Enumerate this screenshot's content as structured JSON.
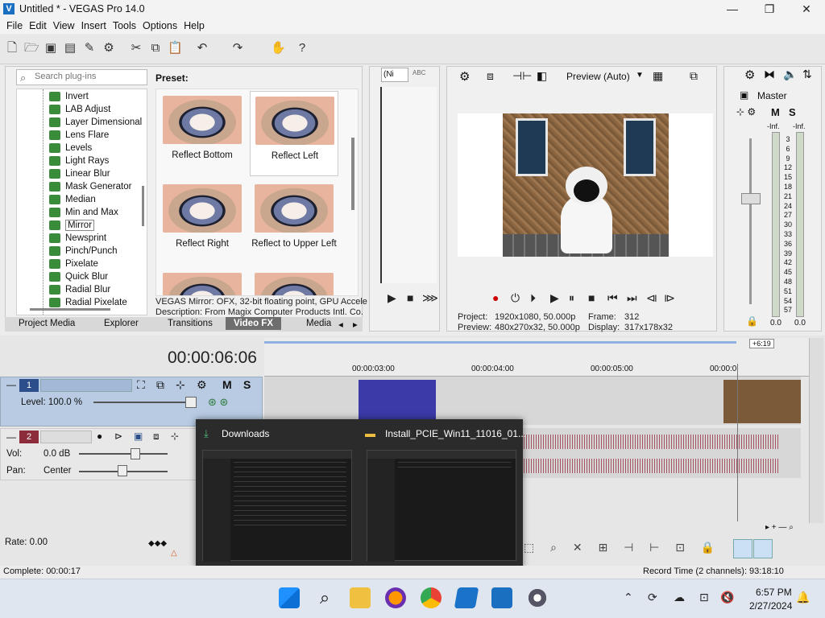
{
  "window": {
    "title": "Untitled * - VEGAS Pro 14.0",
    "logo": "V",
    "minimize": "—",
    "maximize": "❐",
    "close": "✕"
  },
  "menu": [
    "File",
    "Edit",
    "View",
    "Insert",
    "Tools",
    "Options",
    "Help"
  ],
  "plugins": {
    "search_placeholder": "Search plug-ins",
    "items": [
      "Invert",
      "LAB Adjust",
      "Layer Dimensional",
      "Lens Flare",
      "Levels",
      "Light Rays",
      "Linear Blur",
      "Mask Generator",
      "Median",
      "Min and Max",
      "Mirror",
      "Newsprint",
      "Pinch/Punch",
      "Pixelate",
      "Quick Blur",
      "Radial Blur",
      "Radial Pixelate"
    ],
    "selected": "Mirror"
  },
  "preset": {
    "header": "Preset:",
    "items": [
      "Reflect Bottom",
      "Reflect Left",
      "Reflect Right",
      "Reflect to Upper Left"
    ],
    "selected": "Reflect Left",
    "description_line1": "VEGAS Mirror: OFX, 32-bit floating point, GPU Accele",
    "description_line2": "Description: From Magix Computer Products Intl. Co."
  },
  "tabs": [
    "Project Media",
    "Explorer",
    "Transitions",
    "Video FX",
    "Media"
  ],
  "active_tab": "Video FX",
  "trimmer": {
    "zoom": "(Ni",
    "abc": "ABC"
  },
  "preview": {
    "mode": "Preview (Auto)",
    "project_label": "Project:",
    "project_value": "1920x1080, 50.000p",
    "preview_label": "Preview:",
    "preview_value": "480x270x32, 50.000p",
    "frame_label": "Frame:",
    "frame_value": "312",
    "display_label": "Display:",
    "display_value": "317x178x32"
  },
  "master": {
    "title": "Master",
    "m": "M",
    "s": "S",
    "inf_left": "-Inf.",
    "inf_right": "-Inf.",
    "scale": [
      "3",
      "6",
      "9",
      "12",
      "15",
      "18",
      "21",
      "24",
      "27",
      "30",
      "33",
      "36",
      "39",
      "42",
      "45",
      "48",
      "51",
      "54",
      "57"
    ],
    "bottom_left": "0.0",
    "bottom_right": "0.0"
  },
  "timeline": {
    "timecode": "00:00:06:06",
    "marker": "+6:19",
    "ruler": [
      "00:00:03:00",
      "00:00:04:00",
      "00:00:05:00",
      "00:00:0"
    ],
    "track1": {
      "number": "1",
      "m": "M",
      "s": "S",
      "level": "Level: 100.0 %"
    },
    "track2": {
      "number": "2",
      "vol": "Vol:",
      "vol_value": "0.0 dB",
      "pan": "Pan:",
      "pan_value": "Center"
    },
    "rate": "Rate: 0.00"
  },
  "taskpopup": {
    "item1": "Downloads",
    "item2": "Install_PCIE_Win11_11016_01..."
  },
  "status": {
    "complete": "Complete: 00:00:17",
    "record": "Record Time (2 channels): 93:18:10"
  },
  "taskbar": {
    "time": "6:57 PM",
    "date": "2/27/2024"
  },
  "colors": {
    "accent": "#1b6fc1",
    "track_blue": "#b8cbe3",
    "audio_wave": "#9b3a4a",
    "popup_bg": "#2b2b2b"
  }
}
